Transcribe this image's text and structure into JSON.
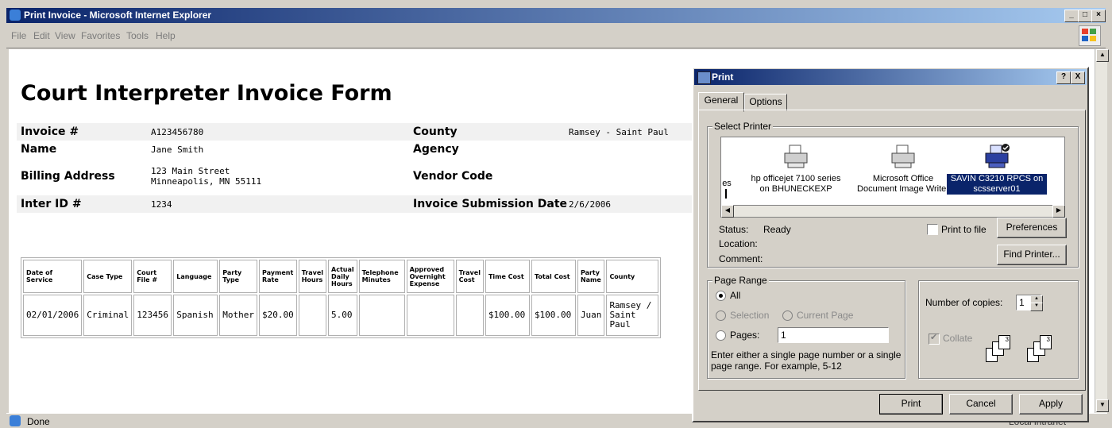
{
  "window": {
    "title": "Print Invoice - Microsoft Internet Explorer",
    "menu": [
      "File",
      "Edit",
      "View",
      "Favorites",
      "Tools",
      "Help"
    ],
    "status": "Done",
    "zone": "Local intranet"
  },
  "invoice": {
    "heading": "Court Interpreter Invoice Form",
    "fields": {
      "invoice_label": "Invoice #",
      "invoice_value": "A123456780",
      "county_label": "County",
      "county_value": "Ramsey - Saint Paul",
      "name_label": "Name",
      "name_value": "Jane Smith",
      "agency_label": "Agency",
      "billing_label": "Billing Address",
      "billing_line1": "123 Main Street",
      "billing_line2": "Minneapolis, MN 55111",
      "vendor_label": "Vendor Code",
      "interid_label": "Inter ID #",
      "interid_value": "1234",
      "subdate_label": "Invoice Submission Date",
      "subdate_value": "2/6/2006"
    },
    "table": {
      "headers": [
        "Date of Service",
        "Case Type",
        "Court File #",
        "Language",
        "Party Type",
        "Payment Rate",
        "Travel Hours",
        "Actual Daily Hours",
        "Telephone Minutes",
        "Approved Overnight Expense",
        "Travel Cost",
        "Time Cost",
        "Total Cost",
        "Party Name",
        "County"
      ],
      "rows": [
        [
          "02/01/2006",
          "Criminal",
          "123456",
          "Spanish",
          "Mother",
          "$20.00",
          "",
          "5.00",
          "",
          "",
          "",
          "$100.00",
          "$100.00",
          "Juan",
          "Ramsey / Saint Paul"
        ]
      ]
    }
  },
  "print_dialog": {
    "title": "Print",
    "tabs": [
      "General",
      "Options"
    ],
    "select_printer_label": "Select Printer",
    "printers": [
      {
        "name": "es",
        "sub": ""
      },
      {
        "name": "hp officejet 7100 series",
        "sub": "on BHUNECKEXP"
      },
      {
        "name": "Microsoft Office",
        "sub": "Document Image Writer"
      },
      {
        "name": "SAVIN C3210 RPCS on",
        "sub": "scsserver01",
        "selected": true
      }
    ],
    "status_label": "Status:",
    "status_value": "Ready",
    "location_label": "Location:",
    "comment_label": "Comment:",
    "print_to_file": "Print to file",
    "preferences": "Preferences",
    "find_printer": "Find Printer...",
    "page_range_label": "Page Range",
    "range_all": "All",
    "range_selection": "Selection",
    "range_current": "Current Page",
    "range_pages": "Pages:",
    "pages_value": "1",
    "range_hint_1": "Enter either a single page number or a single",
    "range_hint_2": "page range.  For example, 5-12",
    "copies_label": "Number of copies:",
    "copies_value": "1",
    "collate": "Collate",
    "btn_print": "Print",
    "btn_cancel": "Cancel",
    "btn_apply": "Apply",
    "help_btn": "?",
    "close_btn": "X"
  }
}
